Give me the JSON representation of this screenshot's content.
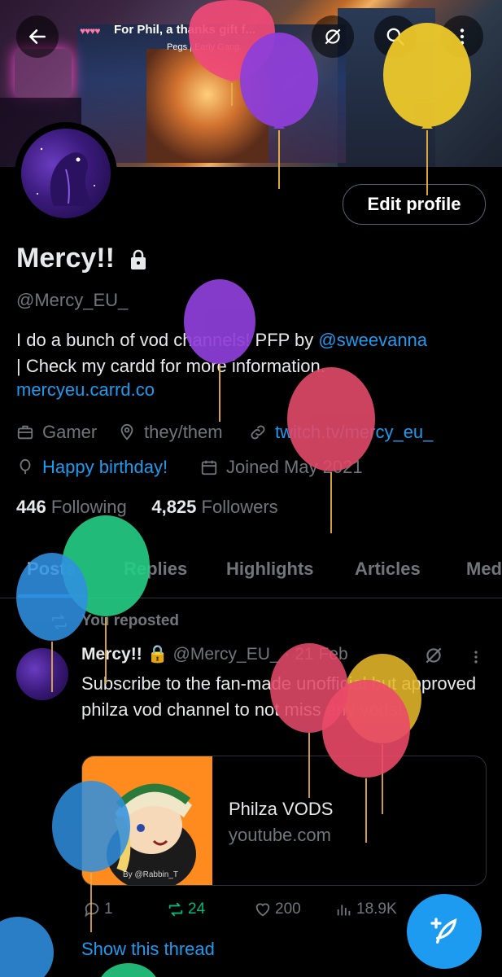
{
  "banner": {
    "title": "For Phil, a thanks gift f...",
    "hearts": "♥♥♥♥",
    "pegs": "Pegs | Early Gang."
  },
  "header": {
    "back_label": "Back",
    "edit_profile": "Edit profile"
  },
  "profile": {
    "name": "Mercy!!",
    "handle": "@Mercy_EU_",
    "bio_1": "I do a bunch of vod channels! PFP by ",
    "bio_mention": "@sweevanna",
    "bio_2": "| Check my cardd for more information.",
    "link": "mercyeu.carrd.co",
    "category": "Gamer",
    "location": "they/them",
    "website": "twitch.tv/mercy_eu_",
    "birthday": "Happy birthday!",
    "joined": "Joined May 2021",
    "following_count": "446",
    "following_label": "Following",
    "followers_count": "4,825",
    "followers_label": "Followers"
  },
  "tabs": [
    "Posts",
    "Replies",
    "Highlights",
    "Articles",
    "Media"
  ],
  "tweet": {
    "reposted": "You reposted",
    "name": "Mercy!!",
    "handle": "@Mercy_EU_",
    "sep": "·",
    "date": "21 Feb",
    "text": "Subscribe to the fan-made unofficial but approved philza vod channel to not miss any vods!",
    "card_title": "Philza VODS",
    "card_domain": "youtube.com",
    "card_credit": "By @Rabbin_T",
    "replies": "1",
    "reposts": "24",
    "likes": "200",
    "views": "18.9K",
    "show_thread": "Show this thread"
  },
  "colors": {
    "accent": "#1d9bf0",
    "repost_green": "#00ba7c",
    "muted": "#71767b"
  },
  "icons": [
    "back-arrow-icon",
    "no-sync-icon",
    "search-icon",
    "more-vertical-icon",
    "lock-icon",
    "briefcase-icon",
    "location-pin-icon",
    "link-icon",
    "balloon-icon",
    "calendar-icon",
    "repost-icon",
    "reply-icon",
    "like-icon",
    "views-icon",
    "compose-icon"
  ]
}
